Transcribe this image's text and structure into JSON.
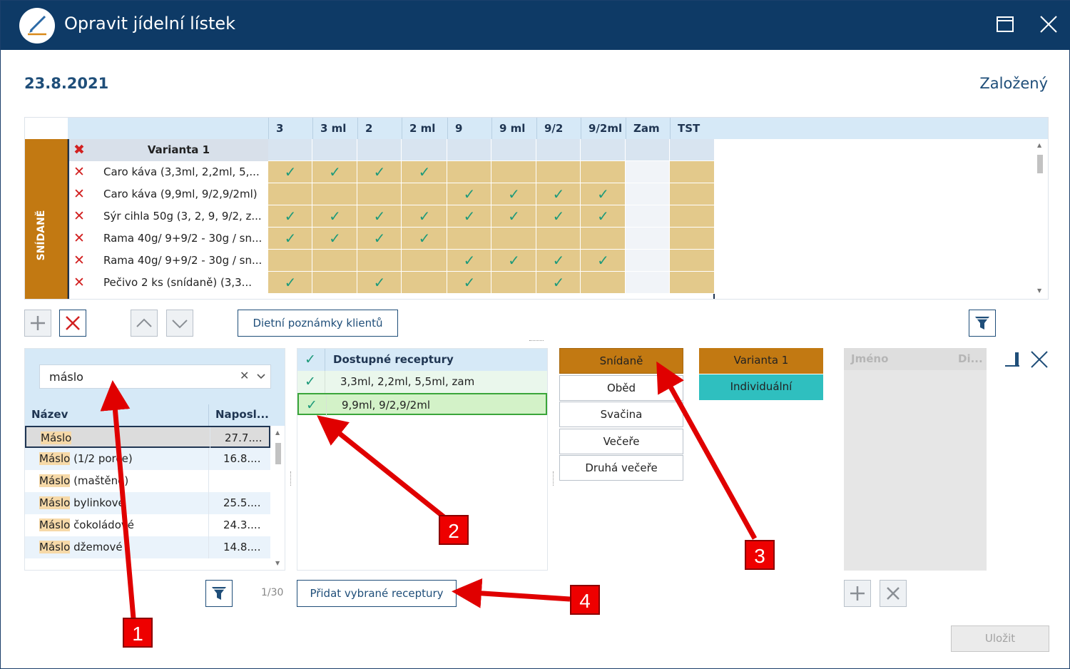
{
  "window": {
    "title": "Opravit jídelní lístek"
  },
  "header": {
    "date": "23.8.2021",
    "status": "Založený"
  },
  "grid": {
    "columns": [
      "3",
      "3 ml",
      "2",
      "2 ml",
      "9",
      "9 ml",
      "9/2",
      "9/2ml",
      "Zam",
      "TST"
    ],
    "meal": "SNÍDANĚ",
    "variant": "Varianta 1",
    "rows": [
      {
        "name": "Caro káva (3,3ml,  2,2ml, 5,...",
        "checks": [
          true,
          true,
          true,
          true,
          false,
          false,
          false,
          false,
          false,
          false
        ]
      },
      {
        "name": "Caro káva (9,9ml, 9/2,9/2ml)",
        "checks": [
          false,
          false,
          false,
          false,
          true,
          true,
          true,
          true,
          false,
          false
        ]
      },
      {
        "name": "Sýr cihla  50g (3, 2, 9, 9/2, z...",
        "checks": [
          true,
          true,
          true,
          true,
          true,
          true,
          true,
          true,
          false,
          false
        ]
      },
      {
        "name": "Rama  40g/ 9+9/2 - 30g / sn...",
        "checks": [
          true,
          true,
          true,
          true,
          false,
          false,
          false,
          false,
          false,
          false
        ]
      },
      {
        "name": "Rama  40g/ 9+9/2 - 30g / sn...",
        "checks": [
          false,
          false,
          false,
          false,
          true,
          true,
          true,
          true,
          false,
          false
        ]
      },
      {
        "name": "Pečivo 2 ks  (snídaně) (3,3...",
        "checks": [
          true,
          false,
          true,
          false,
          true,
          false,
          true,
          false,
          false,
          false
        ]
      }
    ]
  },
  "toolbar": {
    "diet_notes_label": "Dietní poznámky klientů"
  },
  "search": {
    "value": "máslo",
    "col_name": "Název",
    "col_last": "Naposl...",
    "results": [
      {
        "match": "Máslo",
        "rest": "",
        "date": "27.7...."
      },
      {
        "match": "Máslo",
        "rest": " (1/2 porce)",
        "date": "16.8...."
      },
      {
        "match": "Máslo",
        "rest": " (maštěné)",
        "date": ""
      },
      {
        "match": "Máslo",
        "rest": " bylinkové",
        "date": "25.5...."
      },
      {
        "match": "Máslo",
        "rest": " čokoládové",
        "date": "24.3...."
      },
      {
        "match": "Máslo",
        "rest": " džemové",
        "date": "14.8...."
      }
    ],
    "count": "1/30"
  },
  "recipes": {
    "header": "Dostupné receptury",
    "items": [
      "3,3ml,  2,2ml, 5,5ml, zam",
      "9,9ml,  9/2,9/2ml"
    ],
    "add_label": "Přidat vybrané receptury"
  },
  "meals": [
    "Snídaně",
    "Oběd",
    "Svačina",
    "Večeře",
    "Druhá večeře"
  ],
  "variants": [
    "Varianta 1",
    "Individuální"
  ],
  "clients": {
    "col_name": "Jméno",
    "col_di": "Di..."
  },
  "save_label": "Uložit",
  "callouts": [
    "1",
    "2",
    "3",
    "4"
  ],
  "colors": {
    "titlebar": "#0e3a66",
    "meal_band": "#c27912",
    "cell_active": "#e3c98b",
    "header_blue": "#d6e9f7",
    "teal": "#2fbfbf",
    "check": "#1e9a7a",
    "arrow": "#e00000"
  }
}
